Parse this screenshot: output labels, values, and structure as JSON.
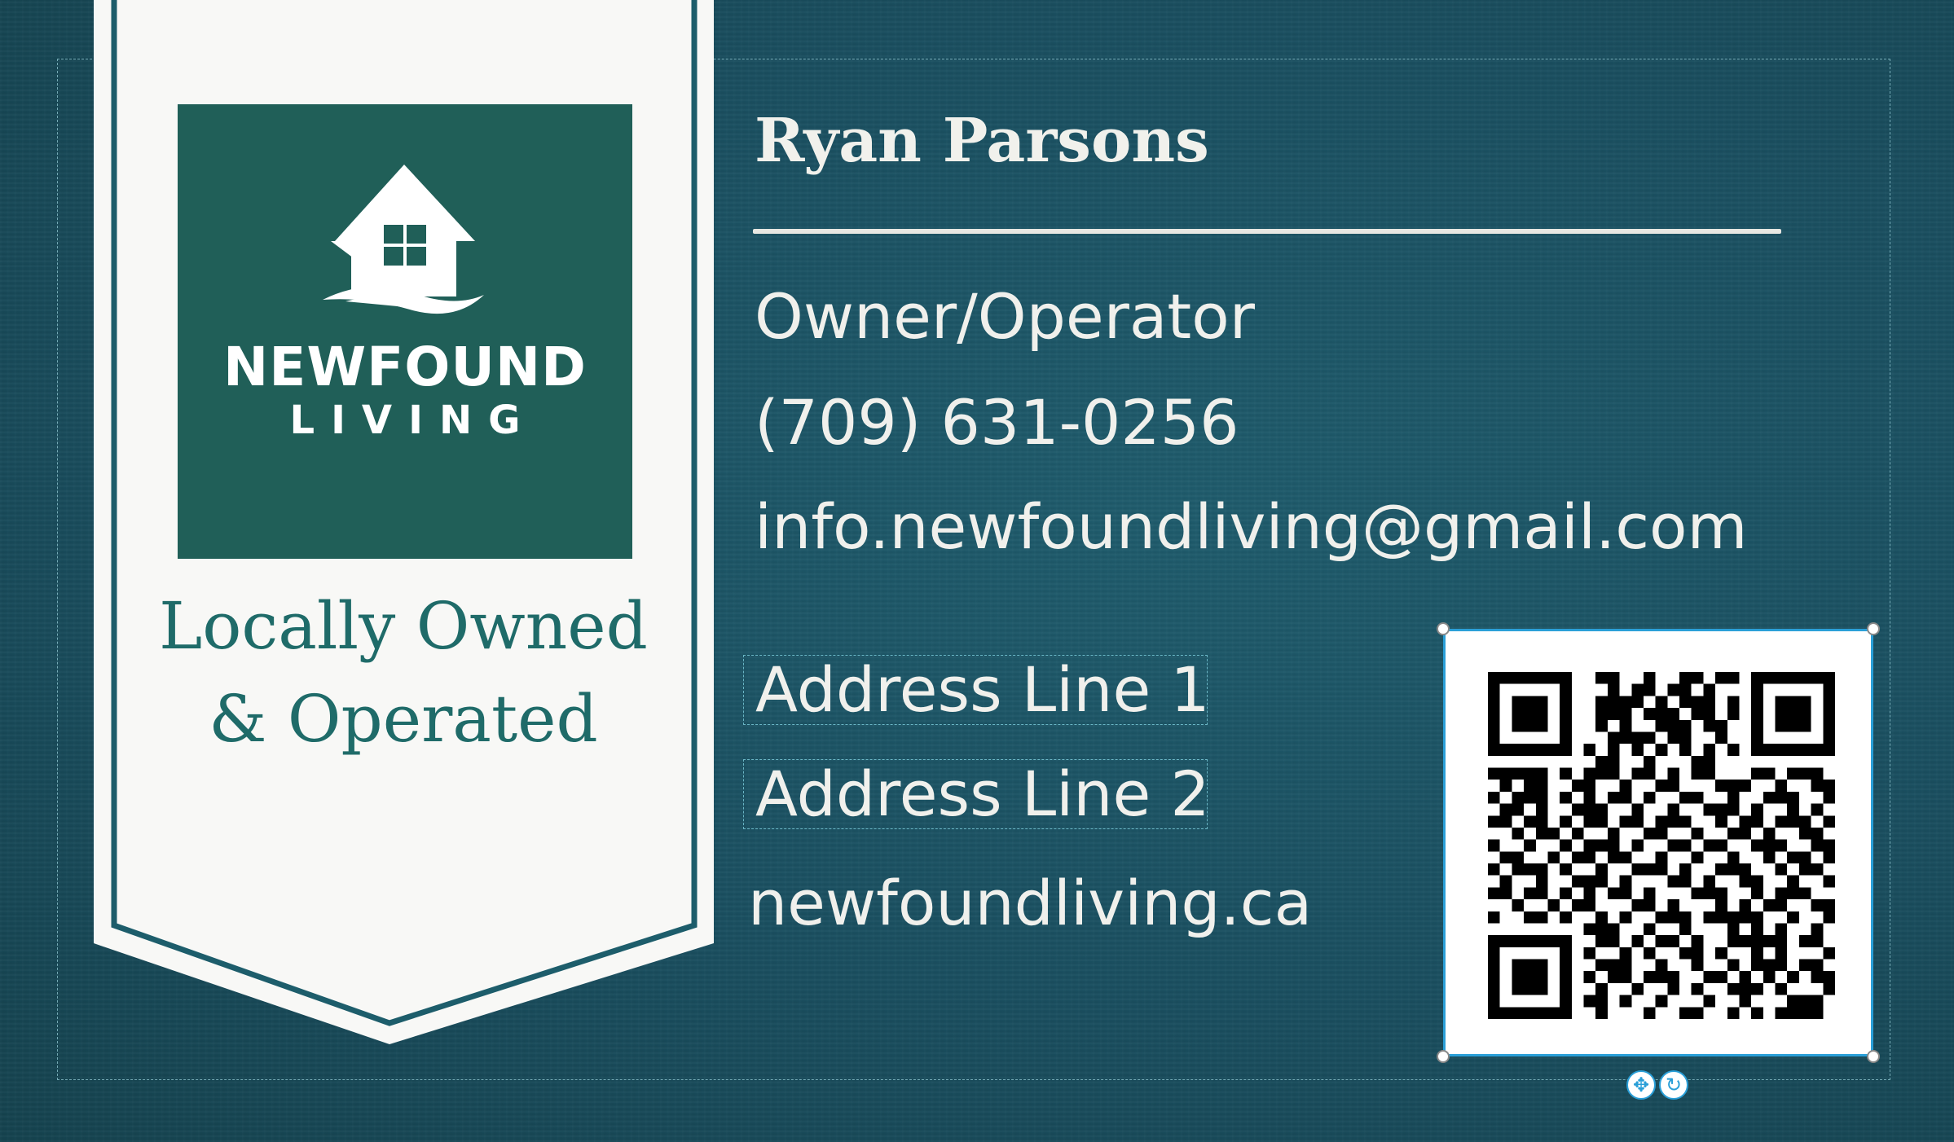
{
  "logo": {
    "brand_line1": "NEWFOUND",
    "brand_line2": "LIVING",
    "icon": "house-icon"
  },
  "tagline": {
    "line1": "Locally Owned",
    "line2": "& Operated"
  },
  "contact": {
    "name": "Ryan Parsons",
    "title": "Owner/Operator",
    "phone": "(709) 631-0256",
    "email": "info.newfoundliving@gmail.com",
    "address_line1": "Address Line 1",
    "address_line2": "Address Line 2",
    "website": "newfoundliving.ca"
  },
  "qr": {
    "icon": "qr-code-icon",
    "selected": true
  },
  "toolbar": {
    "move_icon": "move-icon",
    "rotate_icon": "rotate-icon"
  },
  "colors": {
    "background": "#1b4f5f",
    "banner": "#f7f7f5",
    "logo_green": "#205f58",
    "tagline": "#1f6b69",
    "selection": "#2a9fd8",
    "text_light": "#f0f0ec"
  }
}
